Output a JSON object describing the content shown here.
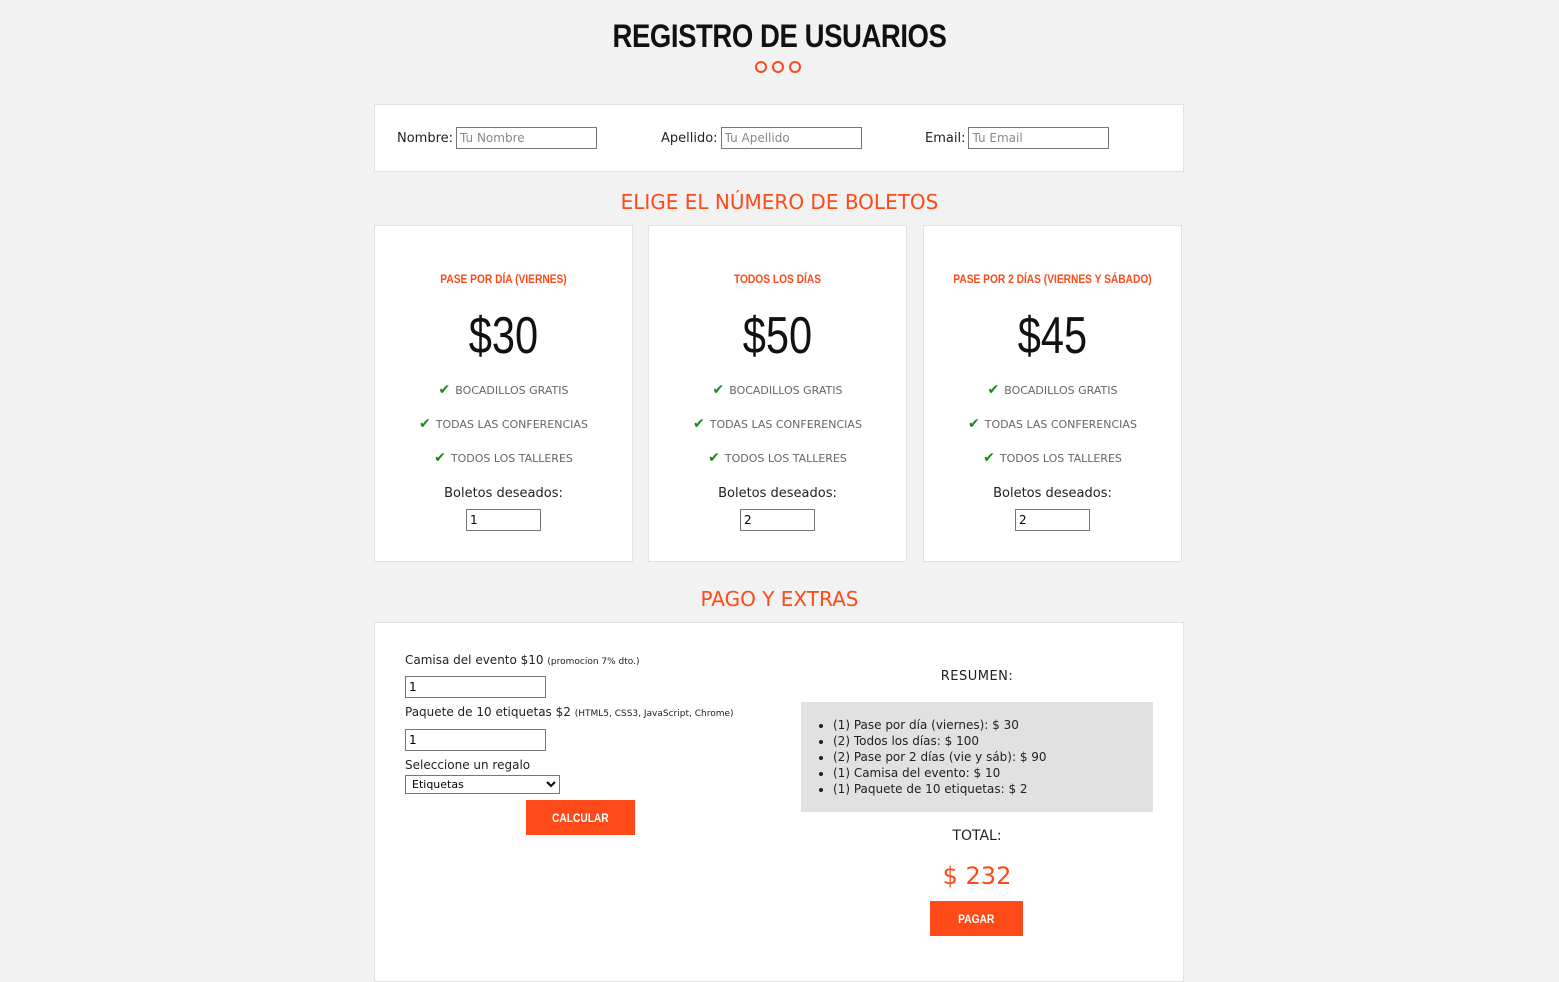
{
  "header": {
    "title": "REGISTRO DE USUARIOS"
  },
  "user_form": {
    "nombre_label": "Nombre:",
    "nombre_placeholder": "Tu Nombre",
    "apellido_label": "Apellido:",
    "apellido_placeholder": "Tu Apellido",
    "email_label": "Email:",
    "email_placeholder": "Tu Email"
  },
  "tickets_section": {
    "title": "ELIGE EL NÚMERO DE BOLETOS",
    "tickets": [
      {
        "name": "PASE POR DÍA (VIERNES)",
        "price": "$30",
        "features": [
          "BOCADILLOS GRATIS",
          "TODAS LAS CONFERENCIAS",
          "TODOS LOS TALLERES"
        ],
        "quantity_label": "Boletos deseados:",
        "quantity": "1"
      },
      {
        "name": "TODOS LOS DÍAS",
        "price": "$50",
        "features": [
          "BOCADILLOS GRATIS",
          "TODAS LAS CONFERENCIAS",
          "TODOS LOS TALLERES"
        ],
        "quantity_label": "Boletos deseados:",
        "quantity": "2"
      },
      {
        "name": "PASE POR 2 DÍAS (VIERNES Y SÁBADO)",
        "price": "$45",
        "features": [
          "BOCADILLOS GRATIS",
          "TODAS LAS CONFERENCIAS",
          "TODOS LOS TALLERES"
        ],
        "quantity_label": "Boletos deseados:",
        "quantity": "2"
      }
    ]
  },
  "payment_section": {
    "title": "PAGO Y EXTRAS",
    "shirt_label": "Camisa del evento $10",
    "shirt_note": "(promocion 7% dto.)",
    "shirt_quantity": "1",
    "labels_label": "Paquete de 10 etiquetas $2",
    "labels_note": "(HTML5, CSS3, JavaScript, Chrome)",
    "labels_quantity": "1",
    "gift_label": "Seleccione un regalo",
    "gift_selected": "Etiquetas",
    "calculate_button": "CALCULAR",
    "summary_title": "RESUMEN:",
    "summary_items": [
      "(1) Pase por día (viernes): $ 30",
      "(2) Todos los días: $ 100",
      "(2) Pase por 2 días (vie y sáb): $ 90",
      "(1) Camisa del evento: $ 10",
      "(1) Paquete de 10 etiquetas: $ 2"
    ],
    "total_title": "TOTAL:",
    "total_amount": "$ 232",
    "pay_button": "PAGAR"
  },
  "colors": {
    "accent": "#fe4918",
    "check": "#148a1e",
    "background": "#f2f2f2",
    "summary_bg": "#e1e1e1"
  },
  "icons": {
    "feature": "check-icon",
    "select": "chevron-down-icon",
    "title_decoration": "circle-icon"
  }
}
